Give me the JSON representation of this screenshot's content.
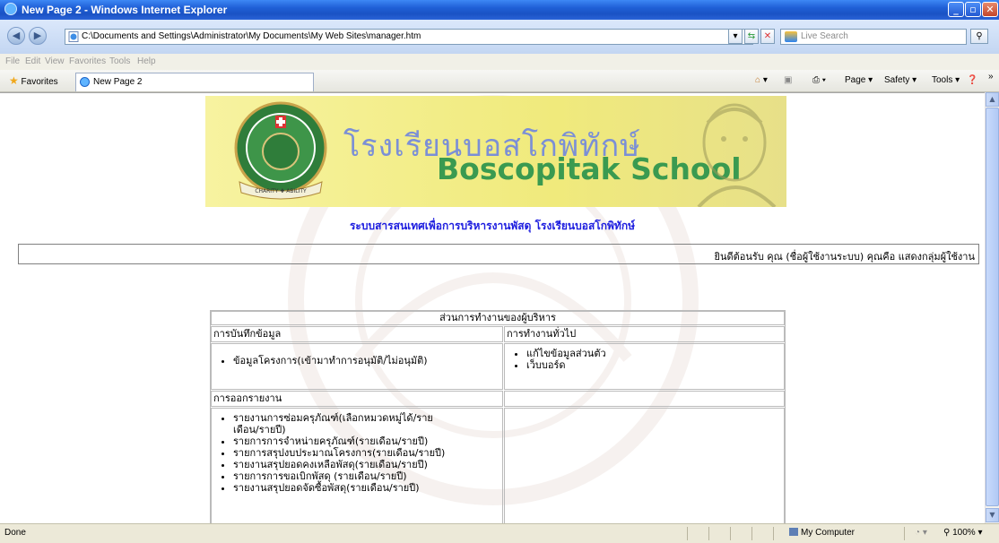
{
  "window": {
    "title": "New Page 2 - Windows Internet Explorer"
  },
  "address": {
    "url": "C:\\Documents and Settings\\Administrator\\My Documents\\My Web Sites\\manager.htm"
  },
  "search": {
    "placeholder": "Live Search"
  },
  "menu": {
    "items": [
      "File",
      "Edit",
      "View",
      "Favorites",
      "Tools",
      "Help"
    ]
  },
  "favorites": {
    "label": "Favorites"
  },
  "tab": {
    "label": "New Page 2"
  },
  "command_bar": {
    "page": "Page ▾",
    "safety": "Safety ▾",
    "tools": "Tools ▾",
    "more": "»"
  },
  "page": {
    "school_thai": "โรงเรียนบอสโกพิทักษ์",
    "school_en": "Boscopitak School",
    "logo_motto": "CHARITY ✚ ABILITY",
    "system_title": "ระบบสารสนเทศเพื่อการบริหารงานพัสดุ โรงเรียนบอสโกพิทักษ์",
    "welcome": "ยินดีต้อนรับ คุณ (ชื่อผู้ใช้งานระบบ) คุณคือ แสดงกลุ่มผู้ใช้งาน",
    "table": {
      "header": "ส่วนการทำงานของผู้บริหาร",
      "record_header": "การบันทึกข้อมูล",
      "general_header": "การทำงานทั่วไป",
      "report_header": "การออกรายงาน",
      "record_items": [
        "ข้อมูลโครงการ(เข้ามาทำการอนุมัติ/ไม่อนุมัติ)"
      ],
      "general_items": [
        "แก้ไขข้อมูลส่วนตัว",
        "เว็บบอร์ด"
      ],
      "report_items": [
        "รายงานการซ่อมครุภัณฑ์(เลือกหมวดหมู่ได้/รายเดือน/รายปี)",
        "รายการการจำหน่ายครุภัณฑ์(รายเดือน/รายปี)",
        "รายการสรุปงบประมาณโครงการ(รายเดือน/รายปี)",
        "รายงานสรุปยอดคงเหลือพัสดุ(รายเดือน/รายปี)",
        "รายการการขอเบิกพัสดุ (รายเดือน/รายปี)",
        "รายงานสรุปยอดจัดซื้อพัสดุ(รายเดือน/รายปี)"
      ]
    }
  },
  "status": {
    "text": "Done",
    "zone": "My Computer",
    "zoom": "100%"
  },
  "colors": {
    "title_blue": "#1d1ddf",
    "banner_yellow": "#f0ea7c",
    "school_green": "#3a9a50",
    "school_thai": "#7b8fd6"
  },
  "icons": [
    "ie-icon",
    "back-icon",
    "forward-icon",
    "page-icon",
    "dropdown-icon",
    "refresh-icon",
    "stop-icon",
    "live-search-icon",
    "search-icon",
    "star-icon",
    "home-icon",
    "feeds-icon",
    "print-icon",
    "help-icon",
    "computer-icon",
    "zoom-icon"
  ]
}
